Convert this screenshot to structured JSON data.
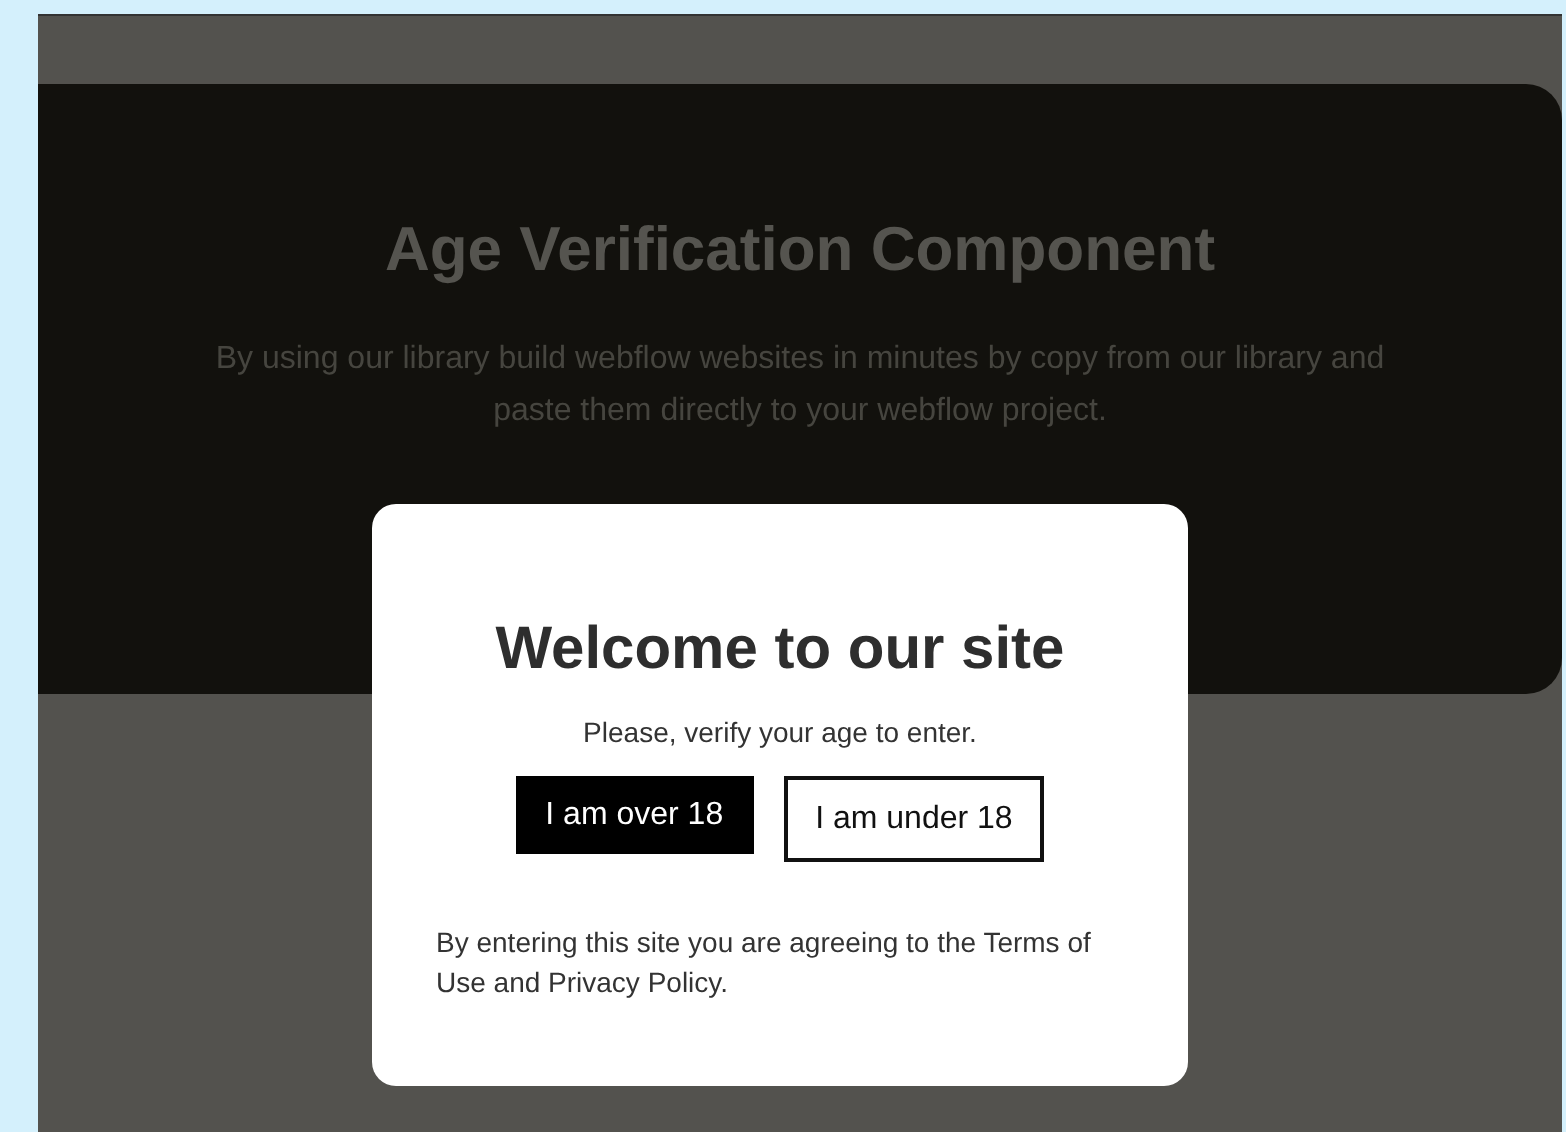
{
  "hero": {
    "title": "Age Verification Component",
    "description": "By using our library build webflow websites in minutes by copy from our library and paste them directly to your webflow project."
  },
  "modal": {
    "title": "Welcome to our site",
    "prompt": "Please, verify your age to enter.",
    "buttons": [
      {
        "label": "I am over 18",
        "kind": "filled"
      },
      {
        "label": "I am under 18",
        "kind": "outline"
      }
    ],
    "disclaimer": "By entering this site you are agreeing to the Terms of Use and Privacy Policy."
  }
}
